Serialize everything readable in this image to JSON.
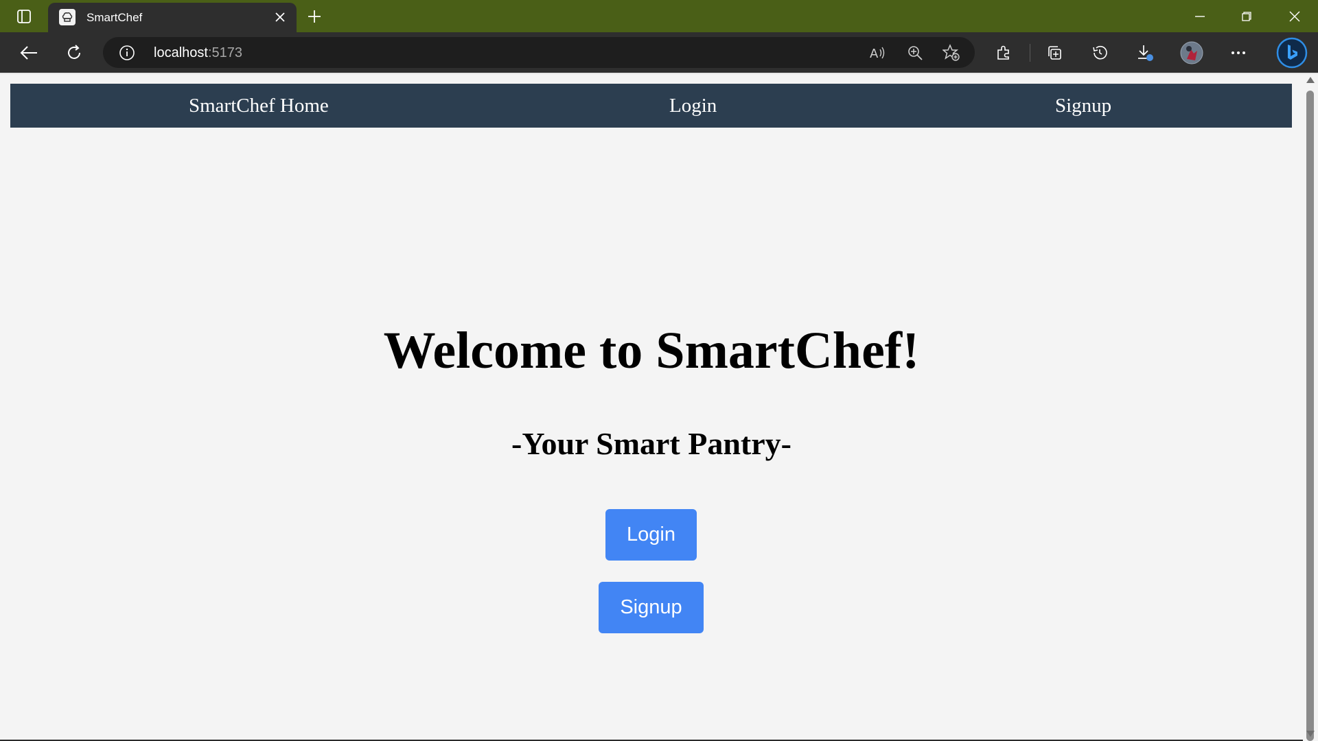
{
  "browser": {
    "tab_title": "SmartChef",
    "address": {
      "host": "localhost",
      "port": ":5173"
    }
  },
  "nav": {
    "home_label": "SmartChef Home",
    "login_label": "Login",
    "signup_label": "Signup"
  },
  "hero": {
    "title": "Welcome to SmartChef!",
    "subtitle": "-Your Smart Pantry-",
    "login_button": "Login",
    "signup_button": "Signup"
  },
  "colors": {
    "titlebar": "#4a5f17",
    "nav_background": "#2c3e50",
    "button_blue": "#4285f4",
    "page_background": "#f4f4f4"
  }
}
